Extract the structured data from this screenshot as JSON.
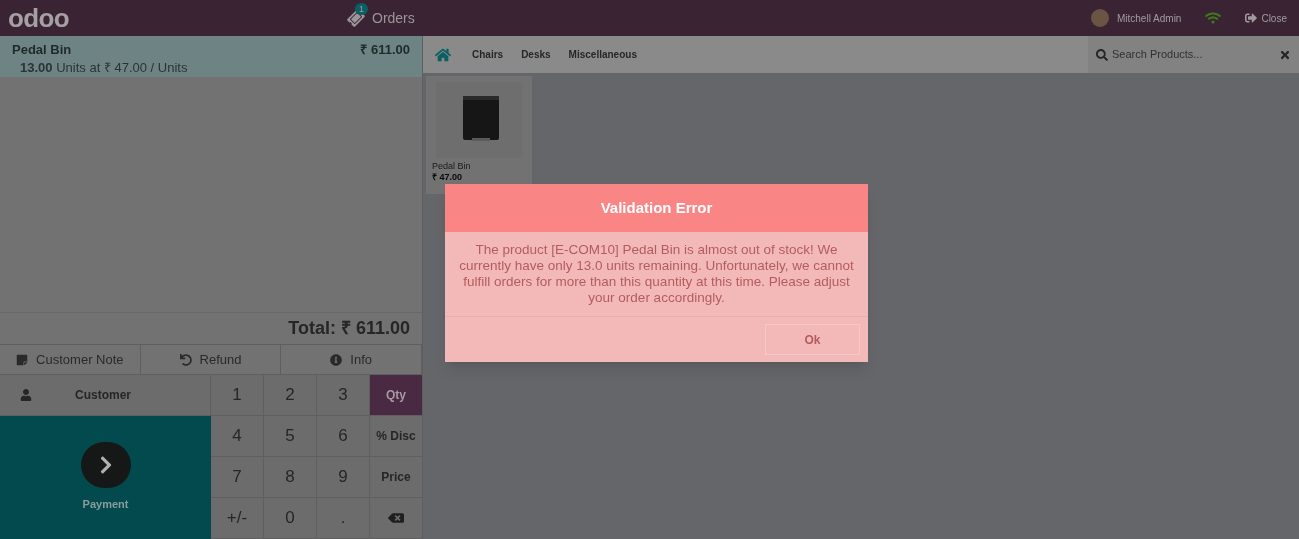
{
  "header": {
    "logo": "odoo",
    "orders_badge": "1",
    "orders_label": "Orders",
    "user": "Mitchell Admin",
    "close": "Close"
  },
  "order_lines": [
    {
      "product": "Pedal Bin",
      "price": "₹ 611.00",
      "quantity": "13.00",
      "detail": "Units at ₹ 47.00 / Units",
      "selected": true
    }
  ],
  "total": "Total: ₹ 611.00",
  "actions": [
    {
      "kind": "note",
      "label": "Customer Note"
    },
    {
      "kind": "refund",
      "label": "Refund"
    },
    {
      "kind": "info",
      "label": "Info"
    }
  ],
  "customer_button": "Customer",
  "payment_button": "Payment",
  "numpad": [
    {
      "kind": "digit",
      "label": "1"
    },
    {
      "kind": "digit",
      "label": "2"
    },
    {
      "kind": "digit",
      "label": "3"
    },
    {
      "kind": "mode",
      "label": "Qty",
      "selected": true
    },
    {
      "kind": "digit",
      "label": "4"
    },
    {
      "kind": "digit",
      "label": "5"
    },
    {
      "kind": "digit",
      "label": "6"
    },
    {
      "kind": "mode",
      "label": "% Disc",
      "selected": false
    },
    {
      "kind": "digit",
      "label": "7"
    },
    {
      "kind": "digit",
      "label": "8"
    },
    {
      "kind": "digit",
      "label": "9"
    },
    {
      "kind": "mode",
      "label": "Price",
      "selected": false
    },
    {
      "kind": "digit",
      "label": "+/-"
    },
    {
      "kind": "digit",
      "label": "0"
    },
    {
      "kind": "digit",
      "label": "."
    },
    {
      "kind": "backspace"
    }
  ],
  "categories": [
    "Chairs",
    "Desks",
    "Miscellaneous"
  ],
  "search": {
    "placeholder": "Search Products..."
  },
  "products": [
    {
      "name": "Pedal Bin",
      "price": "₹ 47.00"
    }
  ],
  "dialog": {
    "title": "Validation Error",
    "message": "The product [E-COM10] Pedal Bin is almost out of stock! We currently have only 13.0 units remaining. Unfortunately, we cannot fulfill orders for more than this quantity at this time. Please adjust your order accordingly.",
    "button": "Ok"
  }
}
